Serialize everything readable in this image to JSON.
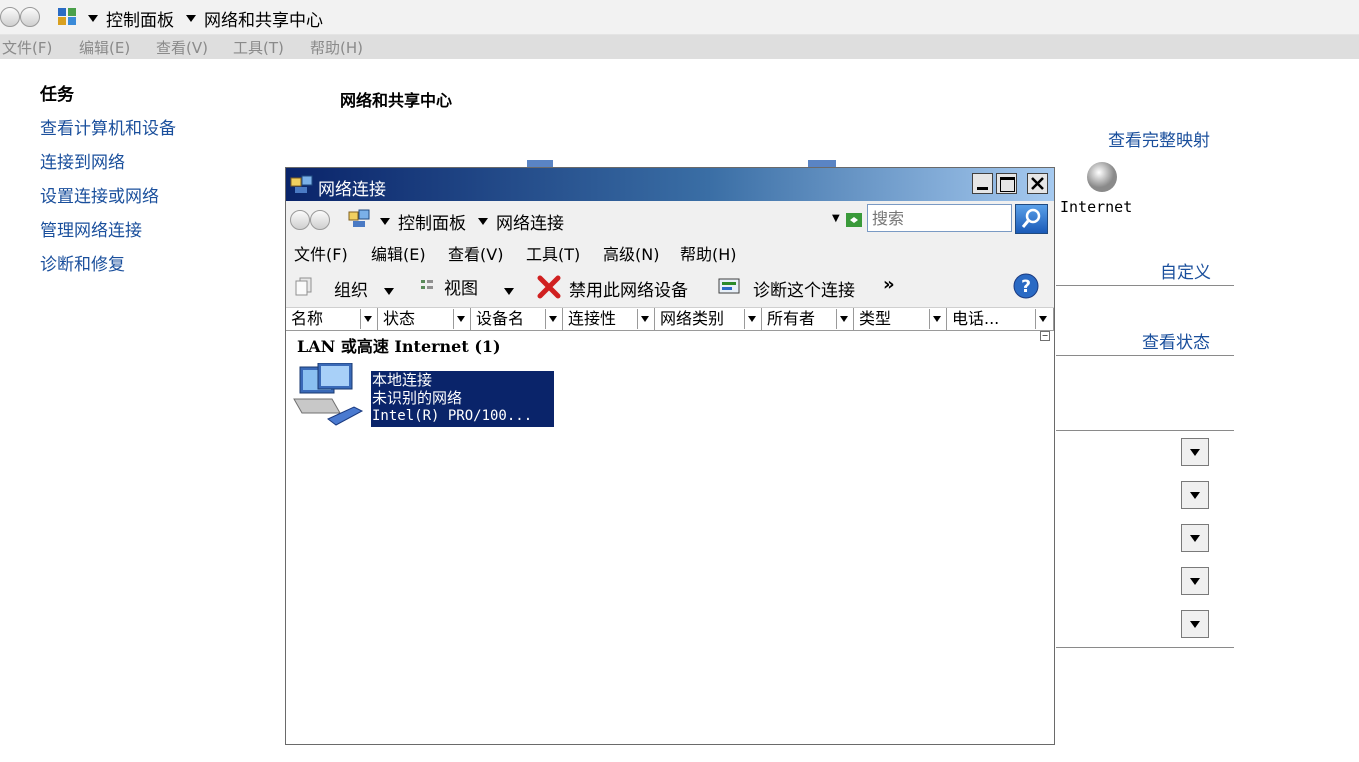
{
  "background_window": {
    "breadcrumb": [
      "控制面板",
      "网络和共享中心"
    ],
    "menu": [
      "文件(F)",
      "编辑(E)",
      "查看(V)",
      "工具(T)",
      "帮助(H)"
    ],
    "tasks_heading": "任务",
    "tasks": [
      "查看计算机和设备",
      "连接到网络",
      "设置连接或网络",
      "管理网络连接",
      "诊断和修复"
    ],
    "page_title": "网络和共享中心",
    "view_full_map": "查看完整映射",
    "internet_label": "Internet",
    "customize_link": "自定义",
    "view_status_link": "查看状态"
  },
  "window": {
    "title": "网络连接",
    "breadcrumb": [
      "控制面板",
      "网络连接"
    ],
    "search_placeholder": "搜索",
    "menu": [
      "文件(F)",
      "编辑(E)",
      "查看(V)",
      "工具(T)",
      "高级(N)",
      "帮助(H)"
    ],
    "toolbar": {
      "organize": "组织",
      "views": "视图",
      "disable": "禁用此网络设备",
      "diagnose": "诊断这个连接",
      "more": "»"
    },
    "columns": [
      "名称",
      "状态",
      "设备名",
      "连接性",
      "网络类别",
      "所有者",
      "类型",
      "电话..."
    ],
    "group_label": "LAN 或高速 Internet (1)",
    "item": {
      "name": "本地连接",
      "status": "未识别的网络",
      "device": "Intel(R) PRO/100..."
    }
  },
  "colors": {
    "link": "#1a4f9c",
    "titlebar_start": "#0a246a",
    "titlebar_end": "#a6caf0",
    "selection": "#0a246a"
  },
  "icons": [
    "back-icon",
    "forward-icon",
    "control-panel-icon",
    "network-connections-icon",
    "refresh-icon",
    "search-icon",
    "organize-icon",
    "views-icon",
    "disable-icon",
    "diagnose-icon",
    "help-icon",
    "network-computer-icon",
    "internet-globe-icon"
  ]
}
